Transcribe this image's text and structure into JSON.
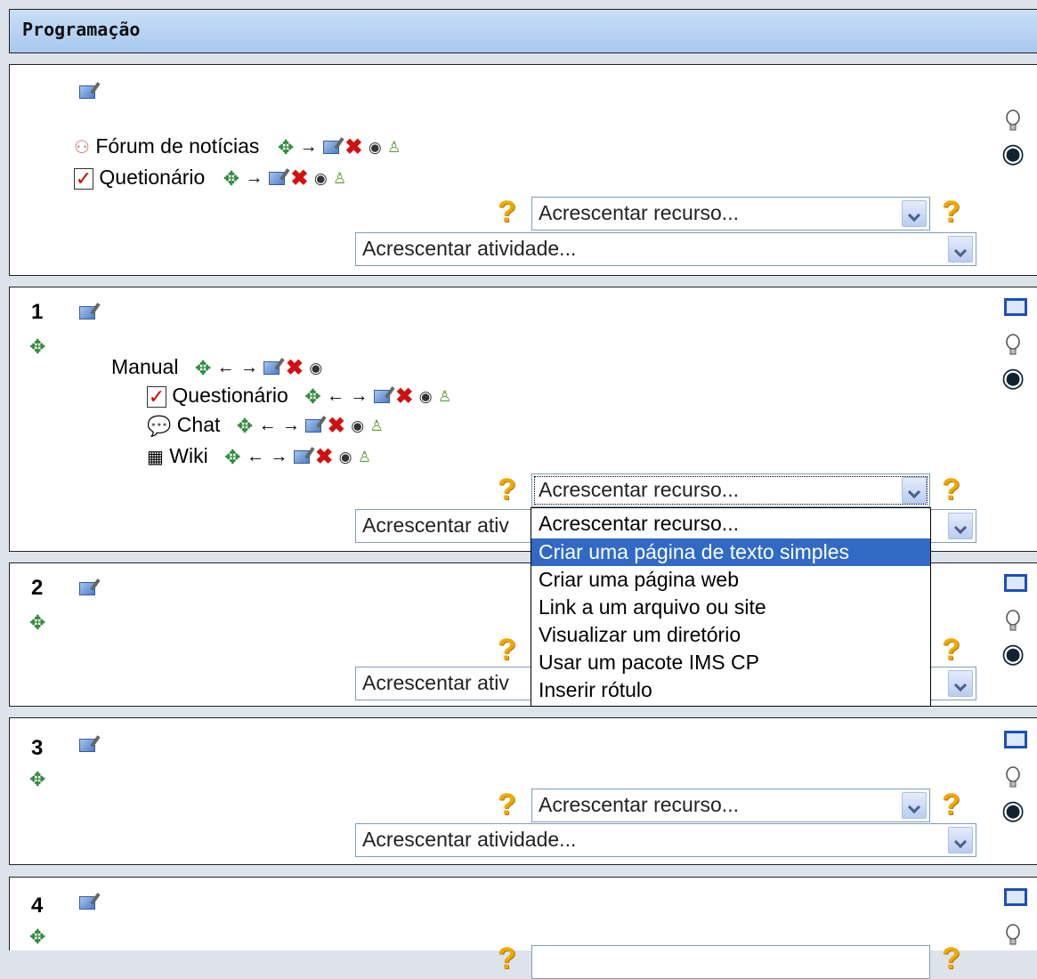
{
  "header": {
    "title": "Programação"
  },
  "section0": {
    "items": [
      "Fórum de notícias",
      "Quetionário"
    ],
    "add_resource": "Acrescentar recurso...",
    "add_activity": "Acrescentar atividade..."
  },
  "section1": {
    "number": "1",
    "label_item": "Manual",
    "items": [
      "Questionário",
      "Chat",
      "Wiki"
    ],
    "add_resource": "Acrescentar recurso...",
    "add_activity": "Acrescentar ativ",
    "dropdown_options": [
      "Acrescentar recurso...",
      "Criar uma página de texto simples",
      "Criar uma página web",
      "Link a um arquivo ou site",
      "Visualizar um diretório",
      "Usar um pacote IMS CP",
      "Inserir rótulo"
    ],
    "highlighted_option": "Criar uma página de texto simples"
  },
  "section2": {
    "number": "2",
    "add_activity": "Acrescentar ativ"
  },
  "section3": {
    "number": "3",
    "add_resource": "Acrescentar recurso...",
    "add_activity": "Acrescentar atividade..."
  },
  "section4": {
    "number": "4"
  },
  "icons": {
    "move": "move-icon",
    "edit": "edit-icon",
    "delete": "delete-icon",
    "hide": "eye-icon",
    "groups": "groups-icon",
    "help": "help-icon",
    "highlight": "lightbulb-icon",
    "show_only": "box-icon"
  },
  "colors": {
    "header_bg": "#b4d0f3",
    "highlight": "#316ac5"
  }
}
